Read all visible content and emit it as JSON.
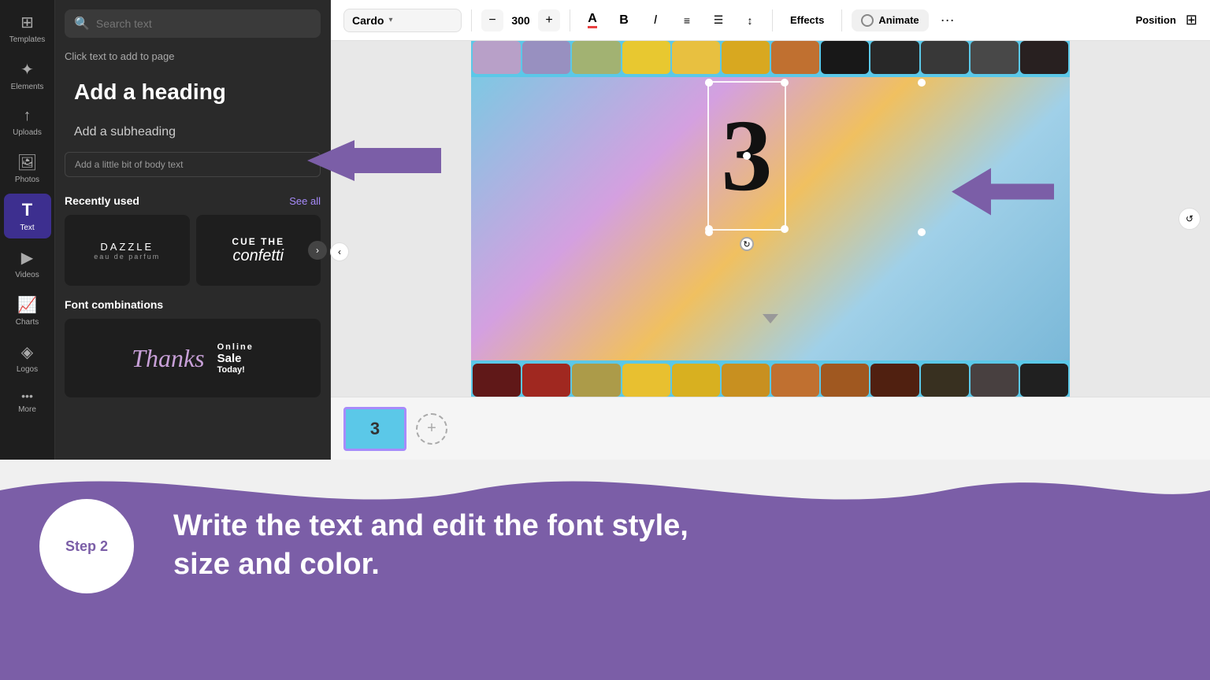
{
  "sidebar": {
    "items": [
      {
        "id": "templates",
        "label": "Templates",
        "icon": "⊞",
        "active": false
      },
      {
        "id": "elements",
        "label": "Elements",
        "icon": "✦",
        "active": false
      },
      {
        "id": "uploads",
        "label": "Uploads",
        "icon": "↑",
        "active": false
      },
      {
        "id": "photos",
        "label": "Photos",
        "icon": "🖼",
        "active": false
      },
      {
        "id": "text",
        "label": "Text",
        "icon": "T",
        "active": true
      },
      {
        "id": "videos",
        "label": "Videos",
        "icon": "▶",
        "active": false
      },
      {
        "id": "charts",
        "label": "Charts",
        "icon": "📈",
        "active": false
      },
      {
        "id": "logos",
        "label": "Logos",
        "icon": "◈",
        "active": false
      },
      {
        "id": "more",
        "label": "More",
        "icon": "•••",
        "active": false
      }
    ]
  },
  "left_panel": {
    "search_placeholder": "Search text",
    "click_hint": "Click text to add to page",
    "heading_label": "Add a heading",
    "subheading_label": "Add a subheading",
    "body_label": "Add a little bit of body text",
    "recently_used_title": "Recently used",
    "see_all_label": "See all",
    "font_combos_title": "Font combinations",
    "font_cards": [
      {
        "id": "dazzle",
        "line1": "DAZZLE",
        "line2": "eau de parfum"
      },
      {
        "id": "cue",
        "line1": "CUE THE",
        "line2": "confetti"
      }
    ]
  },
  "toolbar": {
    "font_name": "Cardo",
    "font_size": "300",
    "minus_label": "−",
    "plus_label": "+",
    "effects_label": "Effects",
    "animate_label": "Animate",
    "more_label": "···",
    "position_label": "Position"
  },
  "canvas": {
    "number_text": "3",
    "film_top_colors": [
      "#b8a0c8",
      "#9890c0",
      "#c8b060",
      "#e8c830",
      "#e8c040",
      "#d8a820",
      "#c07030",
      "#181818",
      "#282828",
      "#383838",
      "#484848",
      "#282020"
    ],
    "film_bottom_colors": [
      "#601818",
      "#a02820",
      "#c89820",
      "#e8c030",
      "#d8b020",
      "#c89020",
      "#c07030",
      "#a05820",
      "#502010",
      "#383020",
      "#484040",
      "#202020"
    ]
  },
  "slide_panel": {
    "slide_number": "3",
    "add_slide_label": "+"
  },
  "annotation": {
    "step_label": "Step 2",
    "text_line1": "Write the text and edit the font style,",
    "text_line2": "size and color."
  },
  "right_panel": {
    "refresh_icon": "↺"
  }
}
